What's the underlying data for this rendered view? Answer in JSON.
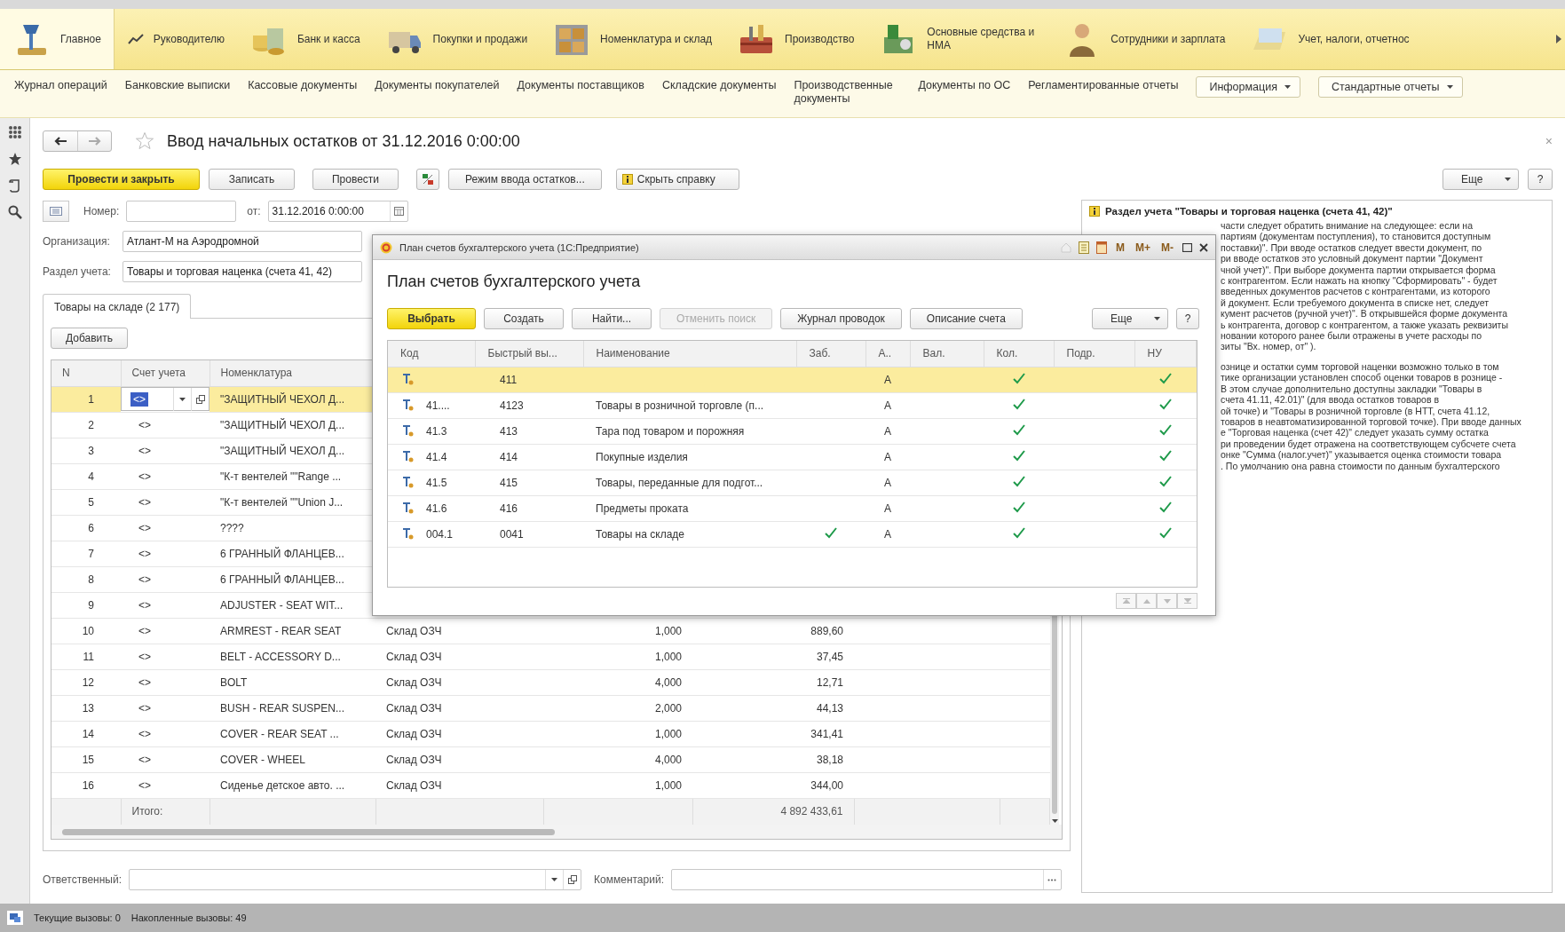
{
  "sections": [
    {
      "label": "Главное",
      "selected": true
    },
    {
      "label": "Руководителю",
      "selected": false
    },
    {
      "label": "Банк и касса",
      "selected": false
    },
    {
      "label": "Покупки и продажи",
      "selected": false
    },
    {
      "label": "Номенклатура и склад",
      "selected": false
    },
    {
      "label": "Производство",
      "selected": false
    },
    {
      "label": "Основные средства и НМА",
      "selected": false
    },
    {
      "label": "Сотрудники и зарплата",
      "selected": false
    },
    {
      "label": "Учет, налоги, отчетнос",
      "selected": false
    }
  ],
  "subnav": [
    {
      "label": "Журнал операций",
      "kind": "link"
    },
    {
      "label": "Банковские выписки",
      "kind": "link"
    },
    {
      "label": "Кассовые документы",
      "kind": "link"
    },
    {
      "label": "Документы покупателей",
      "kind": "link"
    },
    {
      "label": "Документы поставщиков",
      "kind": "link"
    },
    {
      "label": "Складские документы",
      "kind": "link"
    },
    {
      "label": "Производственные документы",
      "kind": "link"
    },
    {
      "label": "Документы по ОС",
      "kind": "link"
    },
    {
      "label": "Регламентированные отчеты",
      "kind": "link"
    },
    {
      "label": "Информация",
      "kind": "menu"
    },
    {
      "label": "Стандартные отчеты",
      "kind": "menu"
    }
  ],
  "form": {
    "title": "Ввод начальных остатков  от 31.12.2016 0:00:00",
    "buttons": [
      {
        "label": "Провести и закрыть",
        "kind": "primary"
      },
      {
        "label": "Записать",
        "kind": "normal"
      },
      {
        "label": "Провести",
        "kind": "normal"
      },
      {
        "kind": "dtkt"
      },
      {
        "label": "Режим ввода остатков...",
        "kind": "normal"
      },
      {
        "label": "Скрыть справку",
        "kind": "help"
      }
    ],
    "close": "×",
    "more": "Еще",
    "help_button": "?",
    "number": {
      "label": "Номер:"
    },
    "date": {
      "label": "от:",
      "value": "31.12.2016  0:00:00"
    },
    "organization": {
      "label": "Организация:",
      "value": "Атлант-М на Аэродромной"
    },
    "section": {
      "label": "Раздел учета:",
      "value": "Товары и торговая наценка (счета 41, 42)"
    },
    "tabs": [
      {
        "label": "Товары на складе (2 177)",
        "selected": true
      }
    ],
    "add_button": "Добавить",
    "table": {
      "columns": [
        "N",
        "Счет учета",
        "Номенклатура"
      ],
      "rows": [
        {
          "n": "1",
          "account": "<>",
          "name": "\"ЗАЩИТНЫЙ ЧЕХОЛ Д...",
          "selected": true
        },
        {
          "n": "2",
          "account": "<>",
          "name": "\"ЗАЩИТНЫЙ ЧЕХОЛ Д...",
          "selected": false
        },
        {
          "n": "3",
          "account": "<>",
          "name": "\"ЗАЩИТНЫЙ ЧЕХОЛ Д...",
          "selected": false
        },
        {
          "n": "4",
          "account": "<>",
          "name": "\"К-т вентелей \"\"Range ...",
          "selected": false
        },
        {
          "n": "5",
          "account": "<>",
          "name": "\"К-т вентелей \"\"Union J...",
          "selected": false
        },
        {
          "n": "6",
          "account": "<>",
          "name": "????",
          "selected": false
        },
        {
          "n": "7",
          "account": "<>",
          "name": "6 ГРАННЫЙ ФЛАНЦЕВ...",
          "selected": false
        },
        {
          "n": "8",
          "account": "<>",
          "name": "6 ГРАННЫЙ ФЛАНЦЕВ...",
          "selected": false
        },
        {
          "n": "9",
          "account": "<>",
          "name": "ADJUSTER - SEAT WIT...",
          "selected": false
        },
        {
          "n": "10",
          "account": "<>",
          "name": "ARMREST - REAR SEAT",
          "warehouse": "Склад ОЗЧ",
          "qty": "1,000",
          "sum": "889,60",
          "selected": false
        },
        {
          "n": "11",
          "account": "<>",
          "name": "BELT - ACCESSORY D...",
          "warehouse": "Склад ОЗЧ",
          "qty": "1,000",
          "sum": "37,45",
          "selected": false
        },
        {
          "n": "12",
          "account": "<>",
          "name": "BOLT",
          "warehouse": "Склад ОЗЧ",
          "qty": "4,000",
          "sum": "12,71",
          "selected": false
        },
        {
          "n": "13",
          "account": "<>",
          "name": "BUSH - REAR SUSPEN...",
          "warehouse": "Склад ОЗЧ",
          "qty": "2,000",
          "sum": "44,13",
          "selected": false
        },
        {
          "n": "14",
          "account": "<>",
          "name": "COVER - REAR SEAT ...",
          "warehouse": "Склад ОЗЧ",
          "qty": "1,000",
          "sum": "341,41",
          "selected": false
        },
        {
          "n": "15",
          "account": "<>",
          "name": "COVER - WHEEL",
          "warehouse": "Склад ОЗЧ",
          "qty": "4,000",
          "sum": "38,18",
          "selected": false
        },
        {
          "n": "16",
          "account": "<>",
          "name": "Сиденье детское авто. ...",
          "warehouse": "Склад ОЗЧ",
          "qty": "1,000",
          "sum": "344,00",
          "selected": false
        }
      ],
      "total": {
        "label": "Итого:",
        "sum": "4 892 433,61"
      }
    },
    "responsible": {
      "label": "Ответственный:"
    },
    "comment": {
      "label": "Комментарий:"
    }
  },
  "help": {
    "title": "Раздел учета \"Товары и торговая наценка (счета 41, 42)\"",
    "paragraphs": [
      [
        "части следует обратить внимание на следующее: если на",
        "партиям (документам поступления), то становится доступным",
        "поставки)\". При вводе остатков следует ввести документ, по",
        "ри вводе остатков это условный документ партии \"Документ",
        "чной учет)\". При выборе документа партии открывается форма",
        "с контрагентом. Если нажать на кнопку \"Сформировать\" - будет",
        "введенных документов расчетов с контрагентами, из которого",
        "й документ. Если требуемого документа в списке нет, следует",
        "кумент расчетов (ручной учет)\". В открывшейся форме документа",
        "ь контрагента, договор с контрагентом, а также указать реквизиты",
        "новании которого ранее были отражены в учете расходы по",
        "зиты \"Вх. номер, от\" )."
      ],
      [
        "ознице и остатки сумм торговой наценки возможно только в том",
        "тике организации установлен способ оценки товаров в рознице -",
        "В этом случае дополнительно доступны закладки \"Товары в",
        "счета 41.11, 42.01)\" (для ввода остатков товаров в",
        "ой точке) и \"Товары в розничной торговле (в НТТ, счета 41.12,",
        "товаров в неавтоматизированной торговой точке). При вводе данных",
        "е \"Торговая наценка (счет 42)\" следует указать сумму остатка",
        "ри проведении будет отражена на соответствующем субсчете счета",
        "онке \"Сумма (налог.учет)\" указывается оценка стоимости товара",
        ". По умолчанию она равна стоимости по данным бухгалтерского"
      ]
    ]
  },
  "dialog": {
    "window_title": "План счетов бухгалтерского учета  (1С:Предприятие)",
    "memory_buttons": [
      "M",
      "M+",
      "M-"
    ],
    "heading": "План счетов бухгалтерского учета",
    "buttons": [
      {
        "label": "Выбрать",
        "kind": "primary",
        "disabled": false
      },
      {
        "label": "Создать",
        "kind": "normal",
        "disabled": false
      },
      {
        "label": "Найти...",
        "kind": "normal",
        "disabled": false
      },
      {
        "label": "Отменить поиск",
        "kind": "normal",
        "disabled": true
      },
      {
        "label": "Журнал проводок",
        "kind": "normal",
        "disabled": false
      },
      {
        "label": "Описание счета",
        "kind": "normal",
        "disabled": false
      }
    ],
    "more": "Еще",
    "help_button": "?",
    "columns": [
      "Код",
      "Быстрый вы...",
      "Наименование",
      "Заб.",
      "А..",
      "Вал.",
      "Кол.",
      "Подр.",
      "НУ"
    ],
    "rows": [
      {
        "code": "",
        "fast": "411",
        "name": "",
        "zab": false,
        "type": "А",
        "kol": true,
        "nu": true,
        "selected": true
      },
      {
        "code": "41....",
        "fast": "4123",
        "name": "Товары в розничной торговле (п...",
        "zab": false,
        "type": "А",
        "kol": true,
        "nu": true,
        "selected": false
      },
      {
        "code": "41.3",
        "fast": "413",
        "name": "Тара под товаром и порожняя",
        "zab": false,
        "type": "А",
        "kol": true,
        "nu": true,
        "selected": false
      },
      {
        "code": "41.4",
        "fast": "414",
        "name": "Покупные изделия",
        "zab": false,
        "type": "А",
        "kol": true,
        "nu": true,
        "selected": false
      },
      {
        "code": "41.5",
        "fast": "415",
        "name": "Товары, переданные для подгот...",
        "zab": false,
        "type": "А",
        "kol": true,
        "nu": true,
        "selected": false
      },
      {
        "code": "41.6",
        "fast": "416",
        "name": "Предметы проката",
        "zab": false,
        "type": "А",
        "kol": true,
        "nu": true,
        "selected": false
      },
      {
        "code": "004.1",
        "fast": "0041",
        "name": "Товары на складе",
        "zab": true,
        "type": "А",
        "kol": true,
        "nu": true,
        "selected": false
      }
    ]
  },
  "status_bar": [
    "Текущие вызовы: 0",
    "Накопленные вызовы: 49"
  ]
}
